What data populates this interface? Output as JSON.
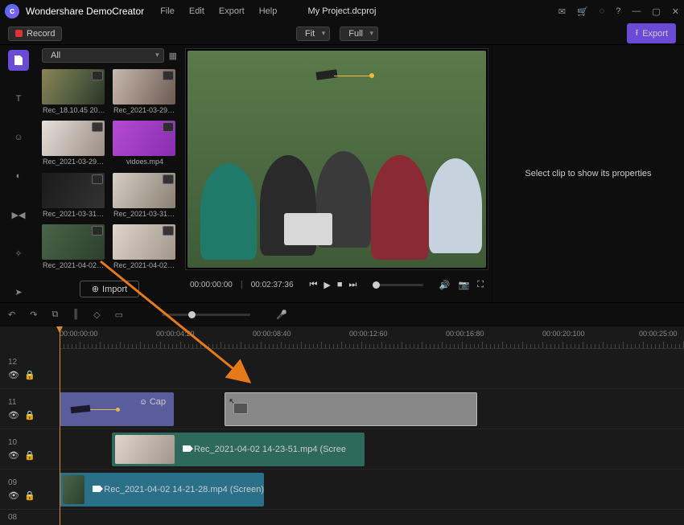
{
  "titlebar": {
    "app_name": "Wondershare DemoCreator",
    "menus": [
      "File",
      "Edit",
      "Export",
      "Help"
    ],
    "project": "My Project.dcproj"
  },
  "toolbar": {
    "record": "Record",
    "fit": "Fit",
    "full": "Full",
    "export": "Export"
  },
  "media": {
    "filter": "All",
    "import": "Import",
    "thumbs": [
      {
        "label": "Rec_18.10.45 2021..."
      },
      {
        "label": "Rec_2021-03-29 09..."
      },
      {
        "label": "Rec_2021-03-29 09..."
      },
      {
        "label": "vidoes.mp4"
      },
      {
        "label": "Rec_2021-03-31 14..."
      },
      {
        "label": "Rec_2021-03-31 16..."
      },
      {
        "label": "Rec_2021-04-02 14..."
      },
      {
        "label": "Rec_2021-04-02 14..."
      }
    ]
  },
  "preview": {
    "time_current": "00:00:00:00",
    "time_total": "00:02:37:36"
  },
  "properties": {
    "placeholder": "Select clip to show its properties"
  },
  "ruler": {
    "labels": [
      "00:00:00:00",
      "00:00:04:20",
      "00:00:08:40",
      "00:00:12:60",
      "00:00:16:80",
      "00:00:20:100",
      "00:00:25:00"
    ]
  },
  "tracks": {
    "nums": [
      "12",
      "11",
      "10",
      "09",
      "08"
    ]
  },
  "clips": {
    "cap": "Cap",
    "mid": "Rec_2021-04-02 14-23-51.mp4 (Scree",
    "bot": "Rec_2021-04-02 14-21-28.mp4 (Screen)"
  }
}
